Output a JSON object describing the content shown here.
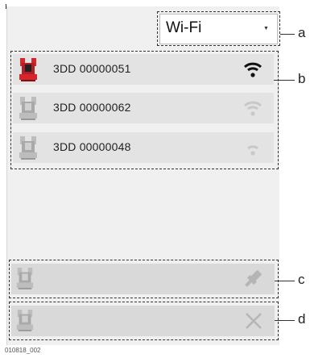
{
  "connection_dropdown": {
    "selected": "Wi-Fi"
  },
  "devices": [
    {
      "name": "3DD 00000051",
      "active": true,
      "signal": "strong",
      "icon": "scanner-instrument-icon"
    },
    {
      "name": "3DD 00000062",
      "active": false,
      "signal": "medium",
      "icon": "scanner-instrument-icon"
    },
    {
      "name": "3DD 00000048",
      "active": false,
      "signal": "weak",
      "icon": "scanner-instrument-icon"
    }
  ],
  "cable_bar": {
    "icon": "usb-plug-icon"
  },
  "disconnect_bar": {
    "icon": "close-icon"
  },
  "callouts": {
    "a": "a",
    "b": "b",
    "c": "c",
    "d": "d"
  },
  "caption": "010818_002",
  "colors": {
    "active_red": "#d6262c",
    "inactive_gray": "#b5b5b5",
    "wifi_dark": "#111111",
    "wifi_light": "#c8c8c8"
  }
}
